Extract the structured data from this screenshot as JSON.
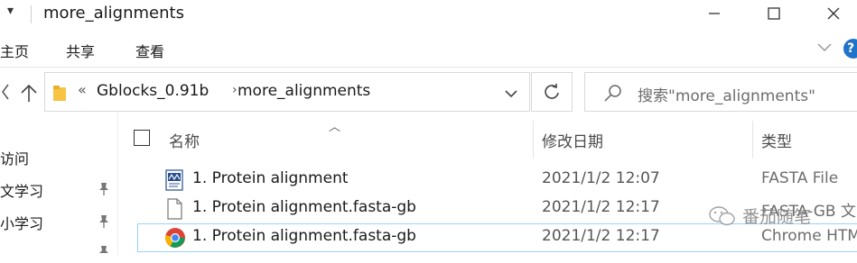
{
  "title_bar": {
    "title": "more_alignments",
    "quick_access_icon": "chevron-down-icon",
    "window_controls": [
      "minimize-icon",
      "maximize-icon",
      "close-icon"
    ]
  },
  "ribbon": {
    "tabs": [
      "主页",
      "共享",
      "查看"
    ],
    "expand_icon": "chevron-down-icon",
    "help_icon": "help-icon",
    "help_label": "?"
  },
  "address_bar": {
    "overflow": "«",
    "crumbs": [
      "Gblocks_0.91b",
      "more_alignments"
    ],
    "separator": "›"
  },
  "search": {
    "placeholder": "搜索\"more_alignments\""
  },
  "nav_pane": {
    "items": [
      {
        "label": "访问",
        "pinned": false
      },
      {
        "label": "文学习",
        "pinned": true
      },
      {
        "label": "小学习",
        "pinned": true
      }
    ]
  },
  "columns": {
    "name": "名称",
    "date": "修改日期",
    "type": "类型"
  },
  "files": [
    {
      "name": "1. Protein alignment",
      "date": "2021/1/2 12:07",
      "type": "FASTA File",
      "icon": "fasta-file-icon"
    },
    {
      "name": "1. Protein alignment.fasta-gb",
      "date": "2021/1/2 12:17",
      "type": "FASTA-GB 文",
      "icon": "blank-file-icon"
    },
    {
      "name": "1. Protein alignment.fasta-gb",
      "date": "2021/1/2 12:17",
      "type": "Chrome HTM",
      "icon": "chrome-icon"
    }
  ],
  "watermark": "番茄随笔",
  "colors": {
    "selection_border": "#99d1ff",
    "help_blue": "#1f73c8",
    "folder_yellow": "#f6c342"
  }
}
